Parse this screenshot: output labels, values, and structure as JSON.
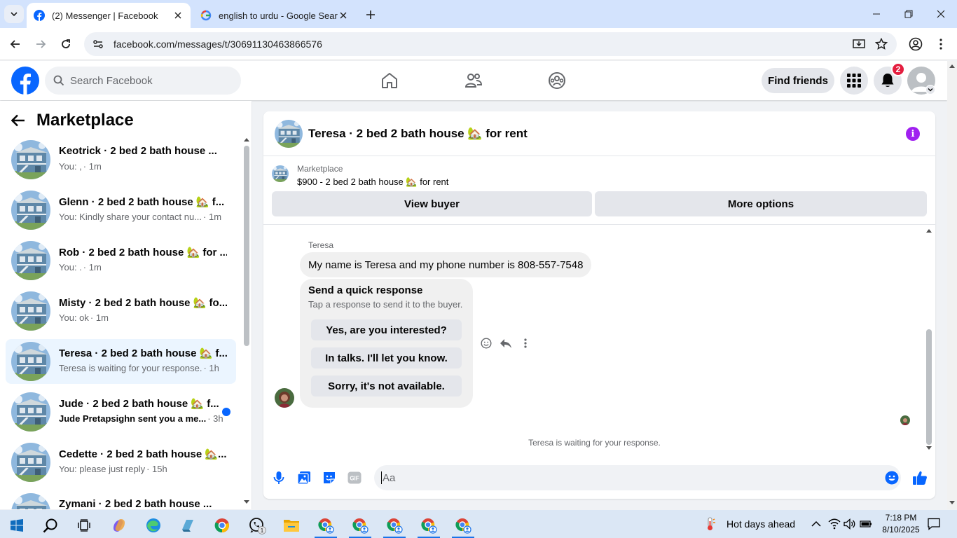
{
  "browser": {
    "tabs": [
      {
        "title": "(2) Messenger | Facebook",
        "active": true
      },
      {
        "title": "english to urdu - Google Search",
        "active": false
      }
    ],
    "url": "facebook.com/messages/t/30691130463866576"
  },
  "facebook": {
    "search_placeholder": "Search Facebook",
    "find_friends": "Find friends",
    "notification_count": "2"
  },
  "sidebar": {
    "title": "Marketplace",
    "conversations": [
      {
        "name": "Keotrick · 2 bed 2 bath house ...",
        "snippet": "You: ,",
        "time": " · 1m",
        "unread": false,
        "selected": false
      },
      {
        "name": "Glenn · 2 bed 2 bath house 🏡 f...",
        "snippet": "You: Kindly share your contact nu...",
        "time": " · 1m",
        "unread": false,
        "selected": false
      },
      {
        "name": "Rob · 2 bed 2 bath house 🏡 for ...",
        "snippet": "You: .",
        "time": " · 1m",
        "unread": false,
        "selected": false
      },
      {
        "name": "Misty · 2 bed 2 bath house 🏡 fo...",
        "snippet": "You: ok",
        "time": " · 1m",
        "unread": false,
        "selected": false
      },
      {
        "name": "Teresa · 2 bed 2 bath house 🏡 f...",
        "snippet": "Teresa is waiting for your response.",
        "time": " · 1h",
        "unread": false,
        "selected": true
      },
      {
        "name": "Jude · 2 bed 2 bath house 🏡 f...",
        "snippet": "Jude Pretapsighn sent you a me...",
        "time": " · 3h",
        "unread": true,
        "selected": false
      },
      {
        "name": "Cedette · 2 bed 2 bath house 🏡...",
        "snippet": "You: please just reply",
        "time": " · 15h",
        "unread": false,
        "selected": false
      },
      {
        "name": "Zymani · 2 bed 2 bath house ...",
        "snippet": "",
        "time": "",
        "unread": false,
        "selected": false
      }
    ]
  },
  "chat": {
    "title": "Teresa · 2 bed 2 bath house 🏡 for rent",
    "marketplace_label": "Marketplace",
    "listing": "$900 - 2 bed 2 bath house 🏡 for rent",
    "view_buyer": "View buyer",
    "more_options": "More options",
    "sender": "Teresa",
    "message": "My name is Teresa and my phone number is 808-557-7548",
    "quick_response": {
      "title": "Send a quick response",
      "subtitle": "Tap a response to send it to the buyer.",
      "options": [
        "Yes, are you interested?",
        "In talks. I'll let you know.",
        "Sorry, it's not available."
      ]
    },
    "waiting_status": "Teresa is waiting for your response.",
    "composer_placeholder": "Aa"
  },
  "taskbar": {
    "weather": "Hot days ahead",
    "time": "7:18 PM",
    "date": "8/10/2025",
    "whatsapp_badge": "1"
  },
  "colors": {
    "fb_blue": "#0866ff",
    "messenger_purple": "#a020f0",
    "selected_bg": "#ebf5ff",
    "chrome_tab_bg": "#d3e3fd"
  }
}
